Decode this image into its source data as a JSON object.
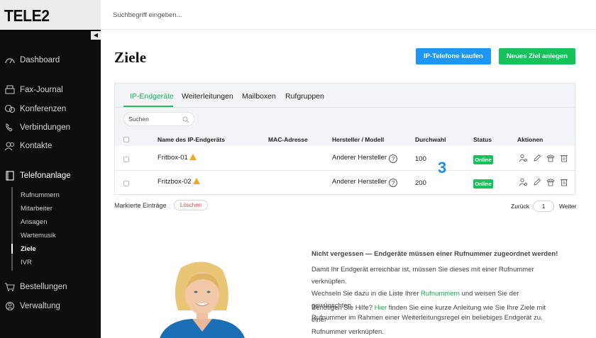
{
  "brand": {
    "logo": "TELE2",
    "collapse_glyph": "◀"
  },
  "top_search": {
    "placeholder": "Suchbegriff eingeben..."
  },
  "sidebar": {
    "items": [
      {
        "label": "Dashboard",
        "icon": "gauge-icon"
      },
      {
        "label": "Fax-Journal",
        "icon": "fax-icon"
      },
      {
        "label": "Konferenzen",
        "icon": "conference-icon"
      },
      {
        "label": "Verbindungen",
        "icon": "phone-icon"
      },
      {
        "label": "Kontakte",
        "icon": "contacts-icon"
      },
      {
        "label": "Telefonanlage",
        "icon": "phone-system-icon"
      },
      {
        "label": "Bestellungen",
        "icon": "cart-icon"
      },
      {
        "label": "Verwaltung",
        "icon": "settings-icon"
      }
    ],
    "sub_items": [
      "Rufnummern",
      "Mitarbeiter",
      "Ansagen",
      "Wartemusik",
      "Ziele",
      "IVR"
    ]
  },
  "page": {
    "title": "Ziele"
  },
  "buttons": {
    "buy": "IP-Telefone kaufen",
    "new_target": "Neues Ziel anlegen"
  },
  "tabs": [
    "IP-Endgeräte",
    "Weiterleitungen",
    "Mailboxen",
    "Rufgruppen"
  ],
  "table": {
    "search_placeholder": "Suchen",
    "headers": [
      "Name des IP-Endgeräts",
      "MAC-Adresse",
      "Hersteller / Modell",
      "Durchwahl",
      "Status",
      "Aktionen"
    ],
    "rows": [
      {
        "name": "Fritbox-01",
        "mac": "",
        "vendor": "Anderer Hersteller",
        "extension": "100",
        "status": "Online"
      },
      {
        "name": "Fritzbox-02",
        "mac": "",
        "vendor": "Anderer Hersteller",
        "extension": "200",
        "status": "Online"
      }
    ]
  },
  "annotation": "3",
  "footer": {
    "marked": "Markierte Einträge",
    "delete": "Löschen",
    "prev": "Zurück",
    "page": "1",
    "next": "Weiter"
  },
  "info": {
    "title": "Nicht vergessen — Endgeräte müssen einer Rufnummer zugeordnet werden!",
    "p1_a": "Damit Ihr Endgerät erreichbar ist, müssen Sie dieses mit einer Rufnummer verknüpfen.",
    "p1_b": "Wechseln Sie dazu in die Liste Ihrer ",
    "p1_link": "Rufnummern",
    "p1_c": " und weisen Sie der gewünschten",
    "p1_d": "Rufnummer im Rahmen einer Weiterleitungsregel ein beliebiges Endgerät zu.",
    "p2_a": "Benötigen Sie Hilfe? ",
    "p2_link": "Hier",
    "p2_b": " finden Sie eine kurze Anleitung wie Sie Ihre Ziele mit einer",
    "p2_c": "Rufnummer verknüpfen."
  },
  "colors": {
    "accent_green": "#17c25a",
    "accent_blue": "#1f97f0",
    "sidebar_bg": "#0d0d0d",
    "annotation_blue": "#1f8ee8"
  }
}
